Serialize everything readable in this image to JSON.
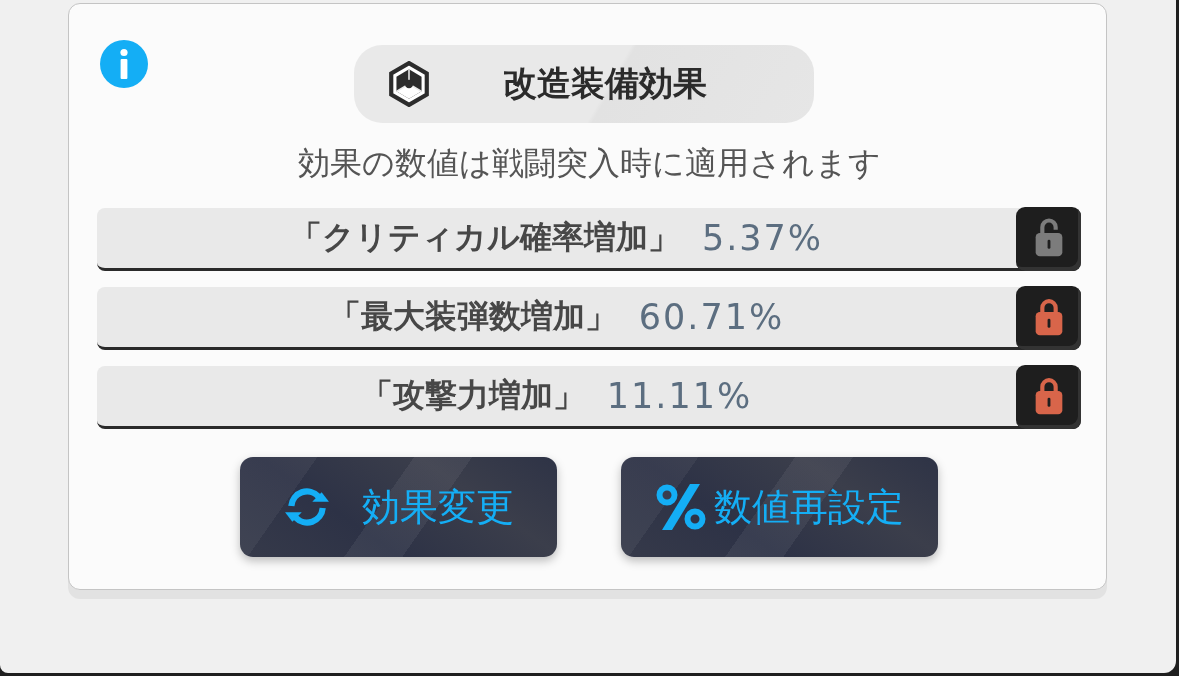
{
  "title": "改造装備効果",
  "subtitle": "効果の数値は戦闘突入時に適用されます",
  "effects": [
    {
      "label": "「クリティカル確率増加」",
      "value": "5.37%",
      "locked": false
    },
    {
      "label": "「最大装弾数増加」",
      "value": "60.71%",
      "locked": true
    },
    {
      "label": "「攻撃力増加」",
      "value": "11.11%",
      "locked": true
    }
  ],
  "buttons": [
    {
      "label": "効果変更",
      "kind": "change"
    },
    {
      "label": "数値再設定",
      "kind": "reroll"
    }
  ]
}
